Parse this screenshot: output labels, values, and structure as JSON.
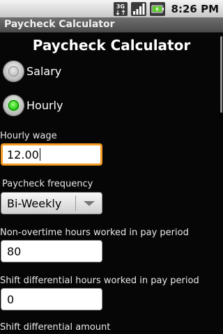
{
  "status_bar": {
    "time": "8:26 PM",
    "network_label": "3G",
    "icons": [
      "3g-data-icon",
      "signal-strength-icon",
      "battery-charging-icon"
    ]
  },
  "app": {
    "title": "Paycheck Calculator"
  },
  "main": {
    "heading": "Paycheck Calculator",
    "pay_type": {
      "options": [
        {
          "label": "Salary",
          "selected": false
        },
        {
          "label": "Hourly",
          "selected": true
        }
      ]
    },
    "hourly_wage": {
      "label": "Hourly wage",
      "value": "12.00"
    },
    "paycheck_frequency": {
      "label": "Paycheck frequency",
      "selected": "Bi-Weekly"
    },
    "non_overtime_hours": {
      "label": "Non-overtime hours worked in pay period",
      "value": "80"
    },
    "shift_diff_hours": {
      "label": "Shift differential hours worked in pay period",
      "value": "0"
    },
    "shift_diff_amount": {
      "label": "Shift differential amount"
    }
  },
  "colors": {
    "focus_border": "#f59a22",
    "radio_selected": "#2ed11a",
    "background": "#000000"
  }
}
